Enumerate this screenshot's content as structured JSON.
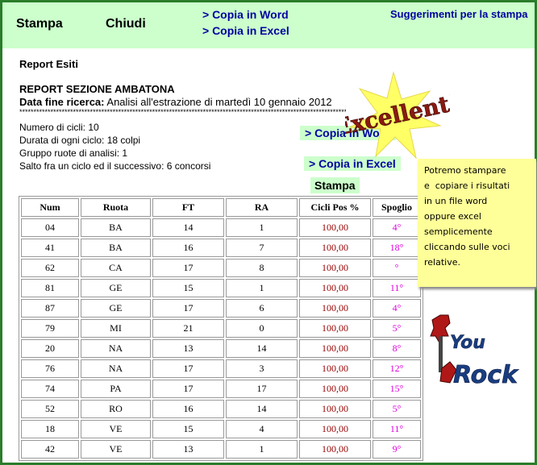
{
  "toolbar": {
    "stampa": "Stampa",
    "chiudi": "Chiudi",
    "copia_word": "> Copia in Word",
    "copia_excel": "> Copia in Excel",
    "suggerimenti": "Suggerimenti per la stampa"
  },
  "report": {
    "title": "Report Esiti",
    "section": "REPORT SEZIONE AMBATONA",
    "date_label": "Data fine ricerca:",
    "date_value": " Analisi all'estrazione di martedì 10 gennaio 2012",
    "stars": "********************************************************************************************************************************",
    "info": [
      "Numero di cicli: 10",
      "Durata di ogni ciclo: 18 colpi",
      "Gruppo ruote di analisi: 1",
      "Salto fra un ciclo ed il successivo: 6 concorsi"
    ]
  },
  "side": {
    "copia_word": "> Copia in Word",
    "copia_excel": "> Copia in Excel",
    "stampa": "Stampa"
  },
  "table": {
    "headers": [
      "Num",
      "Ruota",
      "FT",
      "RA",
      "Cicli Pos %",
      "Spoglio"
    ],
    "rows": [
      [
        "04",
        "BA",
        "14",
        "1",
        "100,00",
        "4°"
      ],
      [
        "41",
        "BA",
        "16",
        "7",
        "100,00",
        "18°"
      ],
      [
        "62",
        "CA",
        "17",
        "8",
        "100,00",
        "°"
      ],
      [
        "81",
        "GE",
        "15",
        "1",
        "100,00",
        "11°"
      ],
      [
        "87",
        "GE",
        "17",
        "6",
        "100,00",
        "4°"
      ],
      [
        "79",
        "MI",
        "21",
        "0",
        "100,00",
        "5°"
      ],
      [
        "20",
        "NA",
        "13",
        "14",
        "100,00",
        "8°"
      ],
      [
        "76",
        "NA",
        "17",
        "3",
        "100,00",
        "12°"
      ],
      [
        "74",
        "PA",
        "17",
        "17",
        "100,00",
        "15°"
      ],
      [
        "52",
        "RO",
        "16",
        "14",
        "100,00",
        "5°"
      ],
      [
        "18",
        "VE",
        "15",
        "4",
        "100,00",
        "11°"
      ],
      [
        "42",
        "VE",
        "13",
        "1",
        "100,00",
        "9°"
      ]
    ]
  },
  "note": {
    "lines": [
      "Potremo stampare",
      "e  copiare i risultati",
      "in un file word",
      "oppure excel",
      "semplicemente",
      "cliccando sulle voci",
      "relative."
    ]
  },
  "stickers": {
    "excellent": "Excellent!",
    "you": "You",
    "rock": "Rock"
  },
  "colors": {
    "toolbar_bg": "#ccffcc",
    "link": "#0000a0",
    "frame": "#2a7d2a",
    "percent": "#990000",
    "spoglio": "#e000e0",
    "note_bg": "#ffff99"
  }
}
